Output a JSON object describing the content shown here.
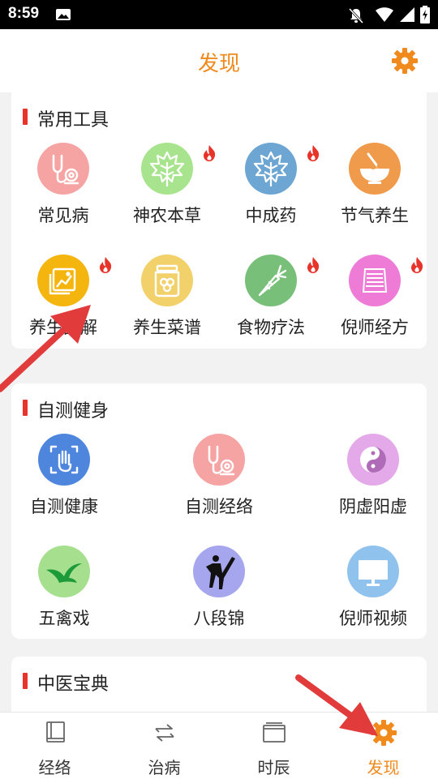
{
  "status_bar": {
    "time": "8:59"
  },
  "header": {
    "title": "发现"
  },
  "sections": [
    {
      "title": "常用工具",
      "items": [
        {
          "label": "常见病",
          "icon": "stethoscope-icon",
          "color": "#f6a3a3",
          "hot": false
        },
        {
          "label": "神农本草",
          "icon": "leaf-icon",
          "color": "#a8e48e",
          "hot": true
        },
        {
          "label": "中成药",
          "icon": "maple-leaf-icon",
          "color": "#6ea6d3",
          "hot": true
        },
        {
          "label": "节气养生",
          "icon": "soup-bowl-icon",
          "color": "#f09a4c",
          "hot": false
        },
        {
          "label": "养生图解",
          "icon": "picture-icon",
          "color": "#f5b50f",
          "hot": true
        },
        {
          "label": "养生菜谱",
          "icon": "jar-icon",
          "color": "#f2d06a",
          "hot": false
        },
        {
          "label": "食物疗法",
          "icon": "carrot-icon",
          "color": "#78c07a",
          "hot": true
        },
        {
          "label": "倪师经方",
          "icon": "document-stack-icon",
          "color": "#ee7bd6",
          "hot": true
        }
      ]
    },
    {
      "title": "自测健身",
      "items": [
        {
          "label": "自测健康",
          "icon": "hand-scan-icon",
          "color": "#4e86dd"
        },
        {
          "label": "自测经络",
          "icon": "stethoscope-icon",
          "color": "#f6a3a3"
        },
        {
          "label": "阴虚阳虚",
          "icon": "yin-yang-icon",
          "color": "#e3a9e9"
        },
        {
          "label": "五禽戏",
          "icon": "bird-icon",
          "color": "#a6e08e"
        },
        {
          "label": "八段锦",
          "icon": "martial-arts-icon",
          "color": "#a5a6ee"
        },
        {
          "label": "倪师视频",
          "icon": "monitor-icon",
          "color": "#8fc3ee"
        }
      ]
    },
    {
      "title": "中医宝典"
    }
  ],
  "tabs": [
    {
      "label": "经络",
      "icon": "book-icon",
      "active": false
    },
    {
      "label": "治病",
      "icon": "exchange-icon",
      "active": false
    },
    {
      "label": "时辰",
      "icon": "calendar-icon",
      "active": false
    },
    {
      "label": "发现",
      "icon": "gear-icon",
      "active": true
    }
  ],
  "colors": {
    "accent": "#f08a1c",
    "section_bar": "#e8332a",
    "hot": "#e8332a",
    "arrow": "#e23b3b"
  }
}
